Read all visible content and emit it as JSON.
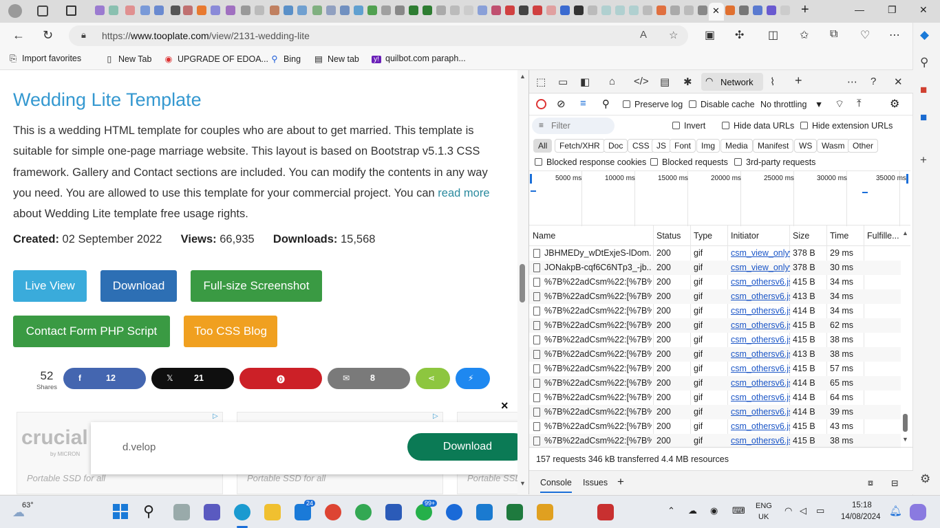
{
  "browser": {
    "window_controls": {
      "minimize": "—",
      "maximize": "❐",
      "close": "✕"
    },
    "new_tab": "+",
    "address": {
      "url_prefix": "https://",
      "url_host": "www.tooplate.com",
      "url_path": "/view/2131-wedding-lite"
    },
    "favorites": [
      {
        "label": "Import favorites",
        "icon": "import-icon"
      },
      {
        "label": "New Tab",
        "icon": "page-icon"
      },
      {
        "label": "UPGRADE OF EDOA...",
        "icon": "chrome-icon"
      },
      {
        "label": "Bing",
        "icon": "search-icon"
      },
      {
        "label": "New tab",
        "icon": "newtab-icon"
      },
      {
        "label": "quilbot.com paraph...",
        "icon": "yahoo-icon"
      }
    ]
  },
  "page": {
    "title": "Wedding Lite Template",
    "desc_before": "This is a wedding HTML template for couples who are about to get married. This template is suitable for simple one-page marriage website. This layout is based on Bootstrap v5.1.3 CSS framework. Gallery and Contact sections are included. You can modify the contents in any way you need. You are allowed to use this template for your commercial project. You can ",
    "desc_link": "read more",
    "desc_after": " about Wedding Lite template free usage rights.",
    "meta": {
      "created_label": "Created:",
      "created_value": "02 September 2022",
      "views_label": "Views:",
      "views_value": "66,935",
      "downloads_label": "Downloads:",
      "downloads_value": "15,568"
    },
    "buttons": {
      "live_view": "Live View",
      "download": "Download",
      "screenshot": "Full-size Screenshot",
      "contact_form": "Contact Form PHP Script",
      "blog": "Too CSS Blog"
    },
    "shares": {
      "total": "52",
      "total_label": "Shares",
      "facebook": "12",
      "x": "21",
      "email": "8"
    },
    "ads": {
      "card_text": "Portable SSD for all",
      "brand": "d.velop",
      "download_label": "Download",
      "close": "×",
      "logo_text": "crucial",
      "logo_sub": "by MICRON"
    }
  },
  "devtools": {
    "panel_tab": "Network",
    "preserve_log": "Preserve log",
    "disable_cache": "Disable cache",
    "throttling": "No throttling",
    "filter_placeholder": "Filter",
    "invert": "Invert",
    "hide_data_urls": "Hide data URLs",
    "hide_extension_urls": "Hide extension URLs",
    "types": [
      "All",
      "Fetch/XHR",
      "Doc",
      "CSS",
      "JS",
      "Font",
      "Img",
      "Media",
      "Manifest",
      "WS",
      "Wasm",
      "Other"
    ],
    "blocked_cookies": "Blocked response cookies",
    "blocked_requests": "Blocked requests",
    "third_party": "3rd-party requests",
    "timeline_labels": [
      "5000 ms",
      "10000 ms",
      "15000 ms",
      "20000 ms",
      "25000 ms",
      "30000 ms",
      "35000 ms"
    ],
    "columns": {
      "name": "Name",
      "status": "Status",
      "type": "Type",
      "initiator": "Initiator",
      "size": "Size",
      "time": "Time",
      "fulfilled": "Fulfille..."
    },
    "rows": [
      {
        "name": "JBHMEDy_wDtExjeS-lDom...",
        "status": "200",
        "type": "gif",
        "initiator": "csm_view_onlyv6",
        "size": "378 B",
        "time": "29 ms"
      },
      {
        "name": "JONakpB-cqf6C6NTp3_-jb...",
        "status": "200",
        "type": "gif",
        "initiator": "csm_view_onlyv6",
        "size": "378 B",
        "time": "30 ms"
      },
      {
        "name": "%7B%22adCsm%22:[%7B%...",
        "status": "200",
        "type": "gif",
        "initiator": "csm_othersv6.js:",
        "size": "415 B",
        "time": "34 ms"
      },
      {
        "name": "%7B%22adCsm%22:[%7B%...",
        "status": "200",
        "type": "gif",
        "initiator": "csm_othersv6.js:",
        "size": "413 B",
        "time": "34 ms"
      },
      {
        "name": "%7B%22adCsm%22:[%7B%...",
        "status": "200",
        "type": "gif",
        "initiator": "csm_othersv6.js:",
        "size": "414 B",
        "time": "34 ms"
      },
      {
        "name": "%7B%22adCsm%22:[%7B%...",
        "status": "200",
        "type": "gif",
        "initiator": "csm_othersv6.js:",
        "size": "415 B",
        "time": "62 ms"
      },
      {
        "name": "%7B%22adCsm%22:[%7B%...",
        "status": "200",
        "type": "gif",
        "initiator": "csm_othersv6.js:",
        "size": "415 B",
        "time": "38 ms"
      },
      {
        "name": "%7B%22adCsm%22:[%7B%...",
        "status": "200",
        "type": "gif",
        "initiator": "csm_othersv6.js:",
        "size": "413 B",
        "time": "38 ms"
      },
      {
        "name": "%7B%22adCsm%22:[%7B%...",
        "status": "200",
        "type": "gif",
        "initiator": "csm_othersv6.js:",
        "size": "415 B",
        "time": "57 ms"
      },
      {
        "name": "%7B%22adCsm%22:[%7B%...",
        "status": "200",
        "type": "gif",
        "initiator": "csm_othersv6.js:",
        "size": "414 B",
        "time": "65 ms"
      },
      {
        "name": "%7B%22adCsm%22:[%7B%...",
        "status": "200",
        "type": "gif",
        "initiator": "csm_othersv6.js:",
        "size": "414 B",
        "time": "64 ms"
      },
      {
        "name": "%7B%22adCsm%22:[%7B%...",
        "status": "200",
        "type": "gif",
        "initiator": "csm_othersv6.js:",
        "size": "414 B",
        "time": "39 ms"
      },
      {
        "name": "%7B%22adCsm%22:[%7B%...",
        "status": "200",
        "type": "gif",
        "initiator": "csm_othersv6.js:",
        "size": "415 B",
        "time": "43 ms"
      },
      {
        "name": "%7B%22adCsm%22:[%7B%...",
        "status": "200",
        "type": "gif",
        "initiator": "csm_othersv6.js:",
        "size": "415 B",
        "time": "38 ms"
      }
    ],
    "summary": "157 requests  346 kB transferred  4.4 MB resources",
    "drawer": {
      "console": "Console",
      "issues": "Issues"
    }
  },
  "taskbar": {
    "weather": "63°",
    "badge_mail": "24",
    "badge_whatsapp": "99+",
    "language": "ENG",
    "region": "UK",
    "time": "15:18",
    "date": "14/08/2024"
  },
  "colors": {
    "live_view": "#3aabdb",
    "download": "#2d6fb4",
    "green": "#3a9a43",
    "orange": "#f0a020",
    "facebook": "#4466b0",
    "x": "#0f0f0f",
    "pinterest": "#cc2027",
    "email": "#7a7a7a",
    "sharethis": "#8dc63f",
    "messenger": "#1e88f0",
    "link": "#2a8a9e",
    "title": "#3498d0"
  }
}
